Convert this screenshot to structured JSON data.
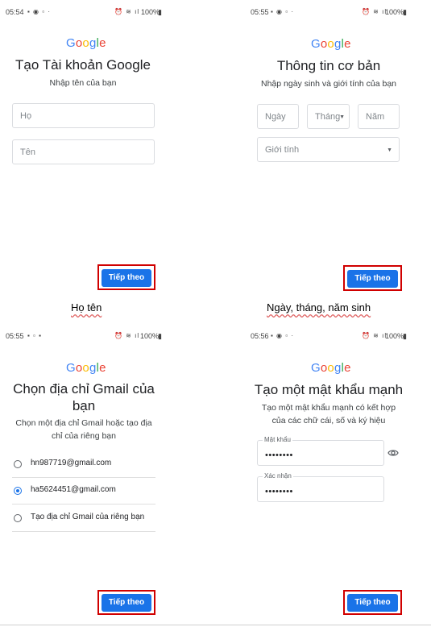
{
  "colors": {
    "accent": "#1a73e8",
    "highlight_box": "#d00000"
  },
  "status": {
    "s1": {
      "time": "05:54",
      "battery": "100%"
    },
    "s2": {
      "time": "05:55",
      "battery": "100%"
    },
    "s3": {
      "time": "05:55",
      "battery": "100%"
    },
    "s4": {
      "time": "05:56",
      "battery": "100%"
    }
  },
  "brand": {
    "g1": "G",
    "g2": "o",
    "g3": "o",
    "g4": "g",
    "g5": "l",
    "g6": "e"
  },
  "screen1": {
    "title": "Tạo Tài khoản Google",
    "subtitle": "Nhập tên của bạn",
    "field_last": "Họ",
    "field_first": "Tên",
    "next": "Tiếp theo",
    "caption": "Họ tên"
  },
  "screen2": {
    "title": "Thông tin cơ bản",
    "subtitle": "Nhập ngày sinh và giới tính của bạn",
    "day": "Ngày",
    "month": "Tháng",
    "year": "Năm",
    "gender": "Giới tính",
    "next": "Tiếp theo",
    "caption": "Ngày, tháng, năm sinh"
  },
  "screen3": {
    "title_line1": "Chọn địa chỉ Gmail của",
    "title_line2": "bạn",
    "subtitle_line1": "Chọn một địa chỉ Gmail hoặc tạo địa",
    "subtitle_line2": "chỉ của riêng bạn",
    "options": [
      {
        "label": "hn987719@gmail.com",
        "selected": false
      },
      {
        "label": "ha5624451@gmail.com",
        "selected": true
      },
      {
        "label": "Tạo địa chỉ Gmail của riêng bạn",
        "selected": false
      }
    ],
    "next": "Tiếp theo"
  },
  "screen4": {
    "title": "Tạo một mật khẩu mạnh",
    "subtitle_line1": "Tạo một mật khẩu mạnh có kết hợp",
    "subtitle_line2": "của các chữ cái, số và ký hiệu",
    "password_label": "Mật khẩu",
    "password_value": "••••••••",
    "confirm_label": "Xác nhận",
    "confirm_value": "••••••••",
    "next": "Tiếp theo"
  }
}
